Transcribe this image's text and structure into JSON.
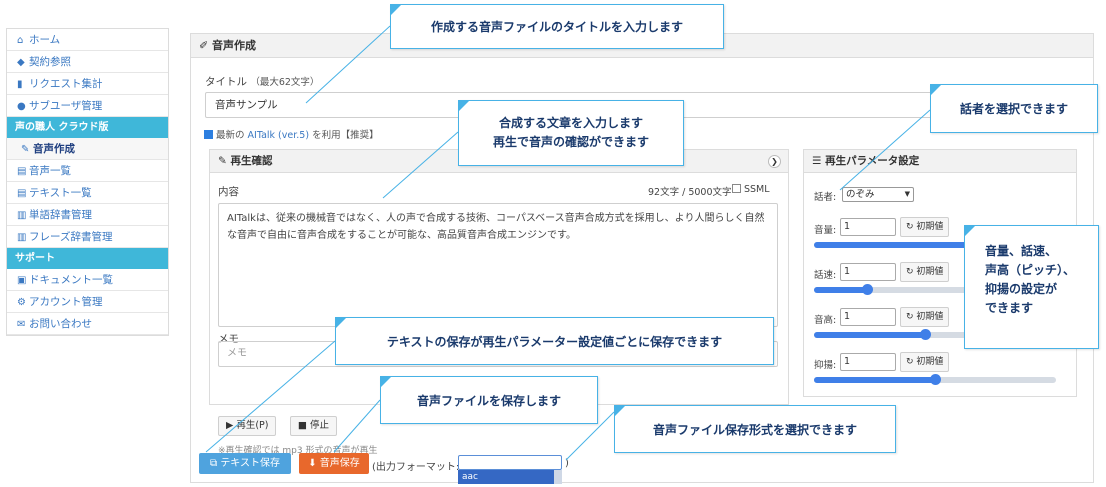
{
  "sidebar": {
    "items": [
      {
        "icon": "home-icon",
        "glyph": "🏠",
        "label": "ホーム"
      },
      {
        "icon": "tag-icon",
        "glyph": "🏷",
        "label": "契約参照"
      },
      {
        "icon": "bar-chart-icon",
        "glyph": "▮",
        "label": "リクエスト集計"
      },
      {
        "icon": "user-icon",
        "glyph": "👤",
        "label": "サブユーザ管理"
      }
    ],
    "section_cloud": "声の職人 クラウド版",
    "cloud_items": [
      {
        "icon": "edit-icon",
        "glyph": "✎",
        "label": "音声作成",
        "active": true
      },
      {
        "icon": "list-icon",
        "glyph": "▤",
        "label": "音声一覧"
      },
      {
        "icon": "list-icon",
        "glyph": "▤",
        "label": "テキスト一覧"
      },
      {
        "icon": "book-icon",
        "glyph": "▥",
        "label": "単語辞書管理"
      },
      {
        "icon": "book-icon",
        "glyph": "▥",
        "label": "フレーズ辞書管理"
      }
    ],
    "section_support": "サポート",
    "support_items": [
      {
        "icon": "briefcase-icon",
        "glyph": "▣",
        "label": "ドキュメント一覧"
      },
      {
        "icon": "gear-icon",
        "glyph": "⚙",
        "label": "アカウント管理"
      },
      {
        "icon": "mail-icon",
        "glyph": "✉",
        "label": "お問い合わせ"
      }
    ]
  },
  "main": {
    "title": "音声作成",
    "title_label": "タイトル",
    "title_hint": "（最大62文字）",
    "title_value": "音声サンプル",
    "latest_prefix": "最新の",
    "latest_link": "AITalk (ver.5)",
    "latest_suffix": "を利用【推奨】",
    "latest_checked": true
  },
  "playback": {
    "title": "再生確認",
    "content_label": "内容",
    "char_count": "92文字 / 5000文字",
    "ssml_label": "SSML",
    "content_text": "AITalkは、従来の機械音ではなく、人の声で合成する技術、コーパスベース音声合成方式を採用し、より人間らしく自然な音声で自由に音声合成をすることが可能な、高品質音声合成エンジンです。",
    "memo_label": "メモ",
    "memo_placeholder": "メモ",
    "play_button": "▶ 再生(P)",
    "stop_button": "■ 停止",
    "note": "※再生確認では mp3 形式の音声が再生"
  },
  "params": {
    "title": "再生パラメータ設定",
    "speaker_label": "話者:",
    "speaker_value": "のぞみ",
    "reset_label": "初期値",
    "rows": [
      {
        "label": "音量:",
        "value": "1",
        "level": 0.73
      },
      {
        "label": "話速:",
        "value": "1",
        "level": 0.22
      },
      {
        "label": "音高:",
        "value": "1",
        "level": 0.46
      },
      {
        "label": "抑揚:",
        "value": "1",
        "level": 0.5
      }
    ]
  },
  "bottom": {
    "save_text": "テキスト保存",
    "save_audio": "音声保存",
    "format_label": "(出力フォーマット:",
    "format_close": ")",
    "format_option": "aac"
  },
  "callouts": {
    "title": "作成する音声ファイルのタイトルを入力します",
    "text_line1": "合成する文章を入力します",
    "text_line2": "再生で音声の確認ができます",
    "speaker": "話者を選択できます",
    "params_line1": "音量、話速、",
    "params_line2": "声高（ピッチ）、",
    "params_line3": "抑揚の設定が",
    "params_line4": "できます",
    "save_text": "テキストの保存が再生パラメーター設定値ごとに保存できます",
    "save_audio": "音声ファイルを保存します",
    "format": "音声ファイル保存形式を選択できます"
  },
  "colors": {
    "accent_cyan": "#3fb7d9",
    "link_blue": "#3a78c2",
    "save_text_button": "#4fa3de",
    "save_audio_button": "#e8682c",
    "slider_blue": "#3f7fe8",
    "callout_border": "#47b2e6"
  }
}
